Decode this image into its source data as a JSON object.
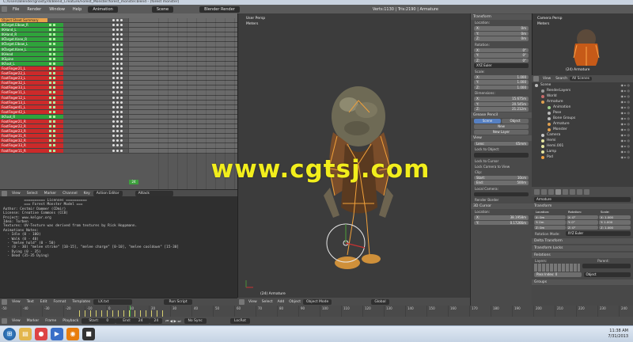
{
  "window": {
    "title": "C:/Users/Blender/gnasty/dl/Blend_Creature/Forest_Monster/forest_monster.blend - [forest monster]"
  },
  "menubar": {
    "menus": [
      "File",
      "Render",
      "Window",
      "Help"
    ],
    "layout": "Animation",
    "scene": "Scene",
    "engine": "Blender Render",
    "stats": "Verts:1130 | Tris:2190 | Armature"
  },
  "nla": {
    "header": "Object Sheet Summary",
    "marker": "24",
    "tracks": [
      {
        "name": "IKTarget.Elbow_R",
        "color": "green"
      },
      {
        "name": "IKHand_L",
        "color": "green"
      },
      {
        "name": "IKHand_R",
        "color": "green"
      },
      {
        "name": "IKTarget.Knee_R",
        "color": "green"
      },
      {
        "name": "IKTarget.Elbow_L",
        "color": "green"
      },
      {
        "name": "IKTarget.Knee_L",
        "color": "green"
      },
      {
        "name": "IKHead",
        "color": "green"
      },
      {
        "name": "IKSpine",
        "color": "green"
      },
      {
        "name": "IKFoot_L",
        "color": "green"
      },
      {
        "name": "FootFinger21_L",
        "color": "red"
      },
      {
        "name": "FootFinger22_L",
        "color": "red"
      },
      {
        "name": "FootFinger23_L",
        "color": "red"
      },
      {
        "name": "FootFinger32_L",
        "color": "red"
      },
      {
        "name": "FootFinger33_L",
        "color": "red"
      },
      {
        "name": "FootFinger11_L",
        "color": "red"
      },
      {
        "name": "FootFinger12_L",
        "color": "red"
      },
      {
        "name": "FootFinger13_L",
        "color": "red"
      },
      {
        "name": "FootFinger41_L",
        "color": "red"
      },
      {
        "name": "FootFinger42_L",
        "color": "red"
      },
      {
        "name": "IKFoot_R",
        "color": "green"
      },
      {
        "name": "FootFinger21_R",
        "color": "red"
      },
      {
        "name": "FootFinger22_R",
        "color": "red"
      },
      {
        "name": "FootFinger23_R",
        "color": "red"
      },
      {
        "name": "FootFinger31_R",
        "color": "red"
      },
      {
        "name": "FootFinger32_R",
        "color": "red"
      },
      {
        "name": "FootFinger33_R",
        "color": "red"
      },
      {
        "name": "FootFinger11_R",
        "color": "red"
      }
    ]
  },
  "action_editor": {
    "menus": [
      "View",
      "Select",
      "Marker",
      "Channel",
      "Key"
    ],
    "mode": "Action Editor",
    "action": "Attack"
  },
  "text_editor": {
    "lines": [
      "          ========== Licenses ==========",
      "          === Forest Monster Model ===",
      "",
      "Author: Cestmir Dammer (CDmir)",
      "License: Creative Commons (CC0)",
      "Project: www.kelgar.org",
      "Idea: Torben",
      "Textures: UV-Texture was derived from textures by Rick Hoppmann.",
      "",
      "Animations Notes:",
      "  - Idle (0 - 100)",
      "  - Walk (0 - 40)",
      "  - \"melee hold\" (0 - 50)",
      "  - (0 - 30) \"melee strike\" [10-15], \"melee charge\" [0-10], \"melee cooldown\" [15-30]",
      "  - Dying (0 - 35)",
      "  - Dead (35-35 Dying)"
    ],
    "menus": [
      "View",
      "Text",
      "Edit",
      "Format",
      "Templates"
    ],
    "file": "LX.txt",
    "run": "Run Script"
  },
  "viewport": {
    "overlay_top": "User Persp",
    "overlay_meters": "Meters",
    "object_label": "(24) Armature",
    "menus": [
      "View",
      "Select",
      "Add",
      "Object"
    ],
    "mode": "Object Mode",
    "orientation": "Global"
  },
  "npanel": {
    "transform": "Transform",
    "location": "Location:",
    "loc": [
      {
        "axis": "X:",
        "val": "0m"
      },
      {
        "axis": "Y:",
        "val": "0m"
      },
      {
        "axis": "Z:",
        "val": "0m"
      }
    ],
    "rotation": "Rotation:",
    "rot": [
      {
        "axis": "X:",
        "val": "0°"
      },
      {
        "axis": "Y:",
        "val": "0°"
      },
      {
        "axis": "Z:",
        "val": "0°"
      }
    ],
    "rotmode": "XYZ Euler",
    "scale": "Scale:",
    "scl": [
      {
        "axis": "X:",
        "val": "1.000"
      },
      {
        "axis": "Y:",
        "val": "1.000"
      },
      {
        "axis": "Z:",
        "val": "1.000"
      }
    ],
    "dimensions": "Dimensions:",
    "dim": [
      {
        "axis": "X:",
        "val": "15.675m"
      },
      {
        "axis": "Y:",
        "val": "20.545m"
      },
      {
        "axis": "Z:",
        "val": "21.212m"
      }
    ],
    "grease": "Grease Pencil",
    "gp_scene": "Scene",
    "gp_object": "Object",
    "gp_new": "New",
    "gp_newlayer": "New Layer",
    "view": "View",
    "lens": "Lens:",
    "lens_val": "65mm",
    "lock_obj": "Lock to Object:",
    "lock_cursor": "Lock to Cursor",
    "lock_cam": "Lock Camera to View",
    "clip": "Clip:",
    "clip_start": "Start:",
    "clip_start_val": "10cm",
    "clip_end": "End:",
    "clip_end_val": "500m",
    "local_cam": "Local Camera:",
    "render_border": "Render Border",
    "cursor3d": "3D Cursor",
    "c_location": "Location:",
    "c_x": "38.1958m",
    "c_y": "0.17266m"
  },
  "camera": {
    "name": "Camera Persp",
    "units": "Meters",
    "label": "(24) Armature"
  },
  "outliner": {
    "menus": [
      "View",
      "Search"
    ],
    "filter": "All Scenes",
    "items": [
      {
        "name": "Scene",
        "indent": 0,
        "color": "#bbbbbb"
      },
      {
        "name": "RenderLayers",
        "indent": 1,
        "color": "#9c9c9c"
      },
      {
        "name": "World",
        "indent": 1,
        "color": "#c86b6b"
      },
      {
        "name": "Armature",
        "indent": 1,
        "color": "#e0a050"
      },
      {
        "name": "Animation",
        "indent": 2,
        "color": "#9cd08b"
      },
      {
        "name": "Pose",
        "indent": 2,
        "color": "#bbbbbb"
      },
      {
        "name": "Bone Groups",
        "indent": 2,
        "color": "#bbbbbb"
      },
      {
        "name": "Armature",
        "indent": 2,
        "color": "#e0a050"
      },
      {
        "name": "Monster",
        "indent": 2,
        "color": "#e0a050"
      },
      {
        "name": "Camera",
        "indent": 1,
        "color": "#c8c8c8"
      },
      {
        "name": "Hemi",
        "indent": 1,
        "color": "#e6e6a0"
      },
      {
        "name": "Hemi.001",
        "indent": 1,
        "color": "#e6e6a0"
      },
      {
        "name": "Lamp",
        "indent": 1,
        "color": "#e6e6a0"
      },
      {
        "name": "Pod",
        "indent": 1,
        "color": "#f0a040"
      }
    ]
  },
  "properties": {
    "object": "Armature",
    "transform": "Transform",
    "location": "Location:",
    "rotation": "Rotation:",
    "scale": "Scale:",
    "rows": [
      [
        "X: 0m",
        "X: 0°",
        "X: 1.000"
      ],
      [
        "Y: 0m",
        "Y: 0°",
        "Y: 1.000"
      ],
      [
        "Z: 0m",
        "Z: 0°",
        "Z: 1.000"
      ]
    ],
    "rotmode_label": "Rotation Mode:",
    "rotmode": "XYZ Euler",
    "delta": "Delta Transform",
    "locks": "Transform Locks",
    "relations": "Relations",
    "layers": "Layers:",
    "parent": "Parent:",
    "pass_index": "Pass Index:",
    "pass_val": "0",
    "parent_type": "Object",
    "groups": "Groups"
  },
  "timeline": {
    "ticks": [
      "-50",
      "-40",
      "-30",
      "-20",
      "-10",
      "0",
      "10",
      "20",
      "30",
      "40",
      "50",
      "60",
      "70",
      "80",
      "90",
      "100",
      "110",
      "120",
      "130",
      "140",
      "150",
      "160",
      "170",
      "180",
      "190",
      "200",
      "210",
      "220",
      "230",
      "240"
    ],
    "menus": [
      "View",
      "Marker",
      "Frame",
      "Playback"
    ],
    "start_label": "Start:",
    "start": "0",
    "end_label": "End:",
    "end": "24",
    "current": "24",
    "sync": "No Sync",
    "keying": "LocRot"
  },
  "taskbar": {
    "time": "11:38 AM",
    "date": "7/31/2013"
  },
  "watermark": "www.cgtsj.com"
}
